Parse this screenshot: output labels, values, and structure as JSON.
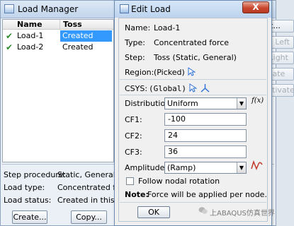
{
  "load_manager": {
    "title": "Load Manager",
    "columns": [
      "Name",
      "Toss"
    ],
    "rows": [
      {
        "name": "Load-1",
        "status": "Created"
      },
      {
        "name": "Load-2",
        "status": "Created"
      }
    ],
    "info": {
      "step_procedure_label": "Step procedure:",
      "step_procedure_value": "Static, General",
      "load_type_label": "Load type:",
      "load_type_value": "Concentrated forc",
      "load_status_label": "Load status:",
      "load_status_value": "Created in this ste"
    },
    "buttons": {
      "create": "Create...",
      "copy": "Copy..."
    },
    "side_buttons": [
      "it...",
      "e Left",
      "Right",
      "vate",
      "ctivate"
    ]
  },
  "edit_load": {
    "title": "Edit Load",
    "close_label": "X",
    "name_label": "Name:",
    "name_value": "Load-1",
    "type_label": "Type:",
    "type_value": "Concentrated force",
    "step_label": "Step:",
    "step_value": "Toss (Static, General)",
    "region_label": "Region:",
    "region_value": "(Picked)",
    "csys_label": "CSYS:",
    "csys_value": "(Global)",
    "distribution_label": "Distribution:",
    "distribution_value": "Uniform",
    "fx_label": "f(x)",
    "cf1_label": "CF1:",
    "cf1_value": "-100",
    "cf2_label": "CF2:",
    "cf2_value": "24",
    "cf3_label": "CF3:",
    "cf3_value": "36",
    "amplitude_label": "Amplitude:",
    "amplitude_value": "(Ramp)",
    "follow_rotation_label": "Follow nodal rotation",
    "note_label": "Note:",
    "note_text": "Force will be applied per node.",
    "ok_label": "OK"
  },
  "watermark": "ABAQUS仿真世界",
  "watermark_prefix": "上",
  "colors": {
    "selection": "#3399ff",
    "check": "#2b8a2b",
    "icon_blue": "#2b6fd6",
    "amp_red": "#c0392b"
  }
}
